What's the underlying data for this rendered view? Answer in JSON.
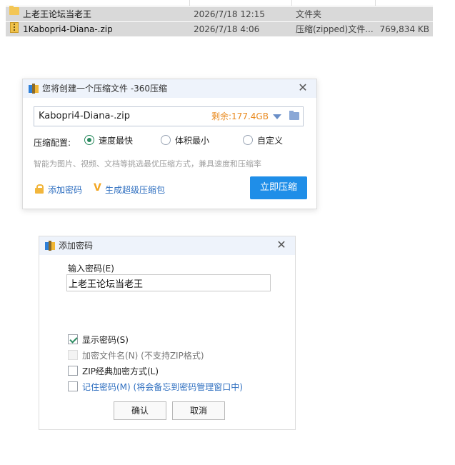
{
  "filelist": {
    "rows": [
      {
        "name": "上老王论坛当老王",
        "date": "2026/7/18 12:15",
        "type": "文件夹",
        "size": ""
      },
      {
        "name": "1Kabopri4-Diana-.zip",
        "date": "2026/7/18 4:06",
        "type": "压缩(zipped)文件...",
        "size": "769,834 KB"
      }
    ]
  },
  "compress_dialog": {
    "title": "您将创建一个压缩文件 -360压缩",
    "filename": "Kabopri4-Diana-.zip",
    "free_space": "剩余:177.4GB",
    "config_label": "压缩配置:",
    "options": [
      "速度最快",
      "体积最小",
      "自定义"
    ],
    "selected_option": "速度最快",
    "hint": "智能为图片、视频、文档等挑选最优压缩方式，兼具速度和压缩率",
    "add_password_link": "添加密码",
    "super_pack_link": "生成超级压缩包",
    "compress_button": "立即压缩"
  },
  "password_dialog": {
    "title": "添加密码",
    "input_label": "输入密码(E)",
    "password_value": "上老王论坛当老王",
    "show_password": "显示密码(S)",
    "encrypt_filenames": "加密文件名(N) (不支持ZIP格式)",
    "zip_classic": "ZIP经典加密方式(L)",
    "remember_password": "记住密码(M) (将会备忘到密码管理窗口中)",
    "ok_button": "确认",
    "cancel_button": "取消"
  }
}
